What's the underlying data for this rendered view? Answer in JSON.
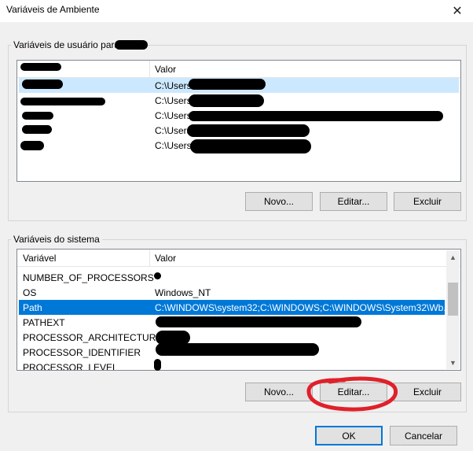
{
  "window": {
    "title": "Variáveis de Ambiente",
    "close_glyph": "✕"
  },
  "user_vars": {
    "label": "Variáveis de usuário para",
    "columns": {
      "variable": "",
      "value": "Valor"
    },
    "rows": [
      {
        "value": "C:\\Users"
      },
      {
        "value": "C:\\Users"
      },
      {
        "value": "C:\\Users"
      },
      {
        "value": "C:\\Users"
      },
      {
        "value": "C:\\Users"
      }
    ],
    "buttons": {
      "new": "Novo...",
      "edit": "Editar...",
      "delete": "Excluir"
    }
  },
  "system_vars": {
    "label": "Variáveis do sistema",
    "columns": {
      "variable": "Variável",
      "value": "Valor"
    },
    "rows": [
      {
        "name": "NUMBER_OF_PROCESSORS",
        "value": ""
      },
      {
        "name": "OS",
        "value": "Windows_NT"
      },
      {
        "name": "Path",
        "value": "C:\\WINDOWS\\system32;C:\\WINDOWS;C:\\WINDOWS\\System32\\Wb..."
      },
      {
        "name": "PATHEXT",
        "value": ""
      },
      {
        "name": "PROCESSOR_ARCHITECTURE",
        "value": ""
      },
      {
        "name": "PROCESSOR_IDENTIFIER",
        "value": ""
      },
      {
        "name": "PROCESSOR_LEVEL",
        "value": ""
      }
    ],
    "buttons": {
      "new": "Novo...",
      "edit": "Editar...",
      "delete": "Excluir"
    }
  },
  "dialog_buttons": {
    "ok": "OK",
    "cancel": "Cancelar"
  },
  "colors": {
    "selection": "#0078d7",
    "annotation": "#e0202a"
  },
  "icons": {
    "close": "close-icon",
    "scroll_up": "chevron-up-icon",
    "scroll_down": "chevron-down-icon"
  }
}
